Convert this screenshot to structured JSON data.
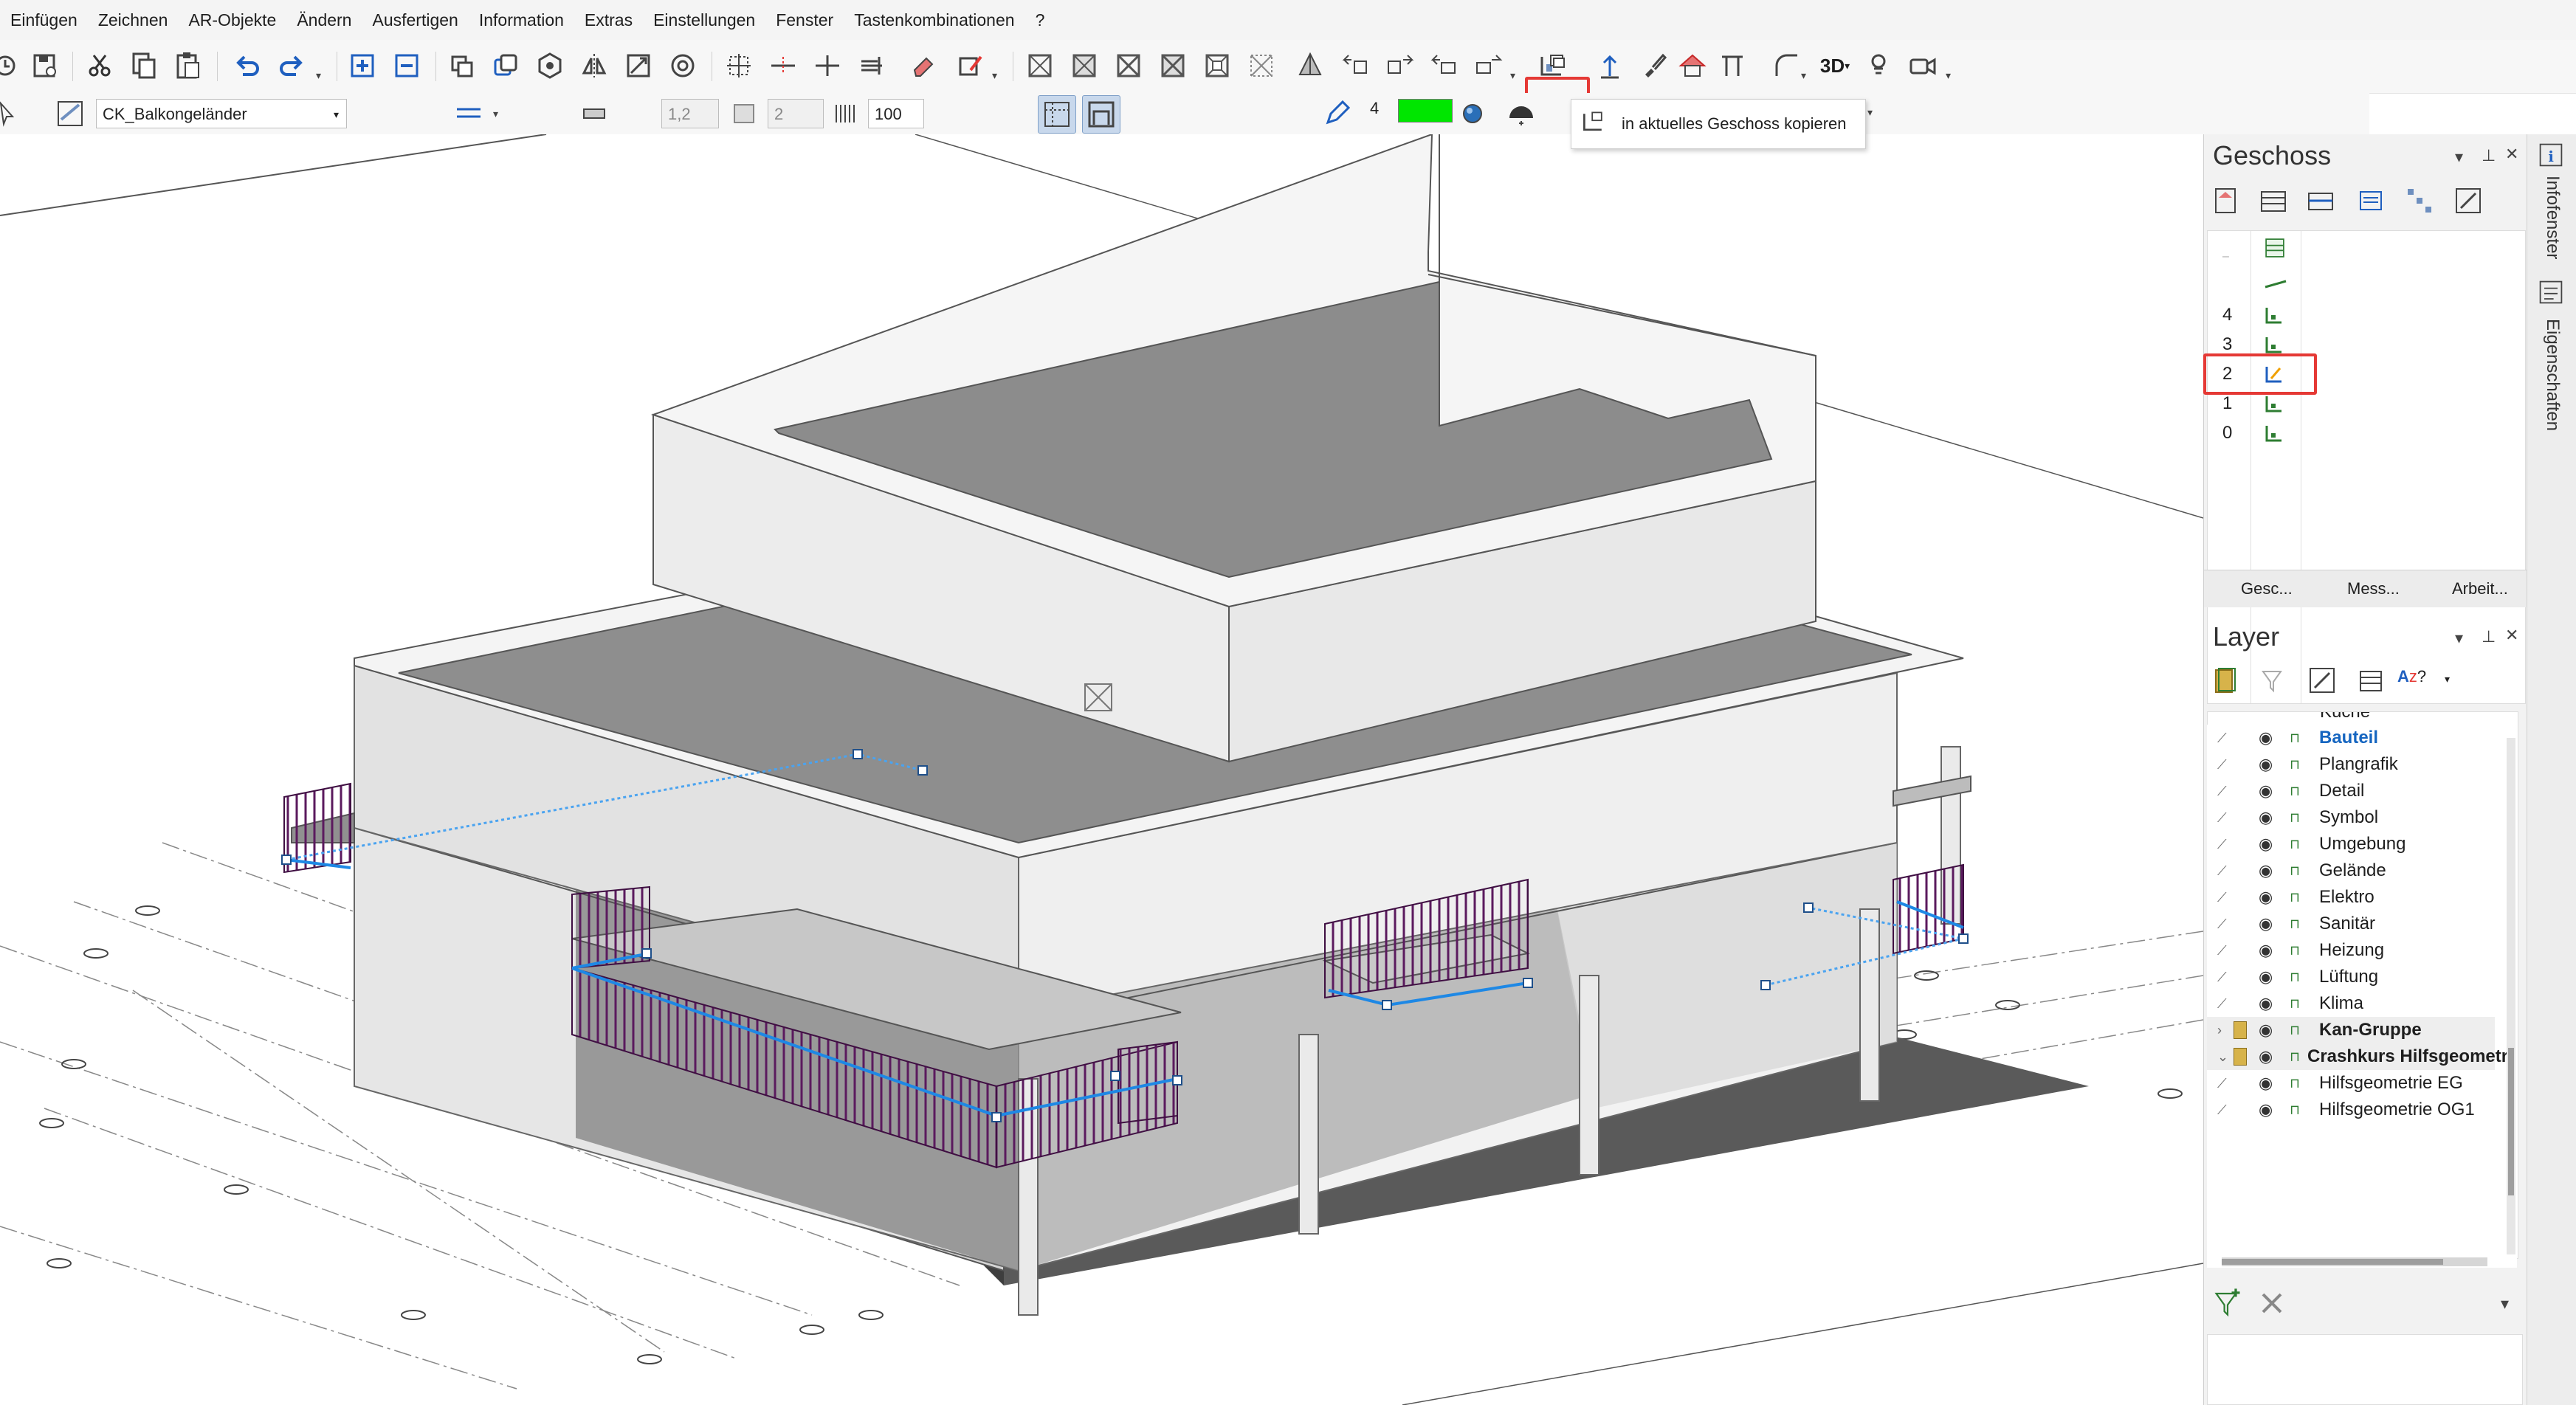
{
  "menu": [
    "Einfügen",
    "Zeichnen",
    "AR-Objekte",
    "Ändern",
    "Ausfertigen",
    "Information",
    "Extras",
    "Einstellungen",
    "Fenster",
    "Tastenkombinationen",
    "?"
  ],
  "toolbar2": {
    "layer_name": "CK_Balkongeländer",
    "value_a": "1,2",
    "value_b": "2",
    "value_c": "100",
    "pen_number": "4",
    "accent_green": "#00e600"
  },
  "tooltip": {
    "text": "in aktuelles Geschoss kopieren"
  },
  "geschoss_panel": {
    "title": "Geschoss",
    "floors": [
      "4",
      "3",
      "2",
      "1",
      "0"
    ],
    "selected_floor": "2",
    "tabs": [
      "Gesc...",
      "Mess...",
      "Arbeit..."
    ]
  },
  "layer_panel": {
    "title": "Layer",
    "top_partial": "Küche",
    "items": [
      {
        "name": "Bauteil",
        "style": "active"
      },
      {
        "name": "Plangrafik",
        "style": "normal"
      },
      {
        "name": "Detail",
        "style": "normal"
      },
      {
        "name": "Symbol",
        "style": "normal"
      },
      {
        "name": "Umgebung",
        "style": "normal"
      },
      {
        "name": "Gelände",
        "style": "normal"
      },
      {
        "name": "Elektro",
        "style": "normal"
      },
      {
        "name": "Sanitär",
        "style": "normal"
      },
      {
        "name": "Heizung",
        "style": "normal"
      },
      {
        "name": "Lüftung",
        "style": "normal"
      },
      {
        "name": "Klima",
        "style": "normal"
      },
      {
        "name": "Kan-Gruppe",
        "style": "group"
      },
      {
        "name": "Crashkurs Hilfsgeometr",
        "style": "group-open"
      },
      {
        "name": "Hilfsgeometrie EG",
        "style": "child"
      },
      {
        "name": "Hilfsgeometrie OG1",
        "style": "child"
      }
    ]
  },
  "side_tabs": [
    "Infofenster",
    "Eigenschaften"
  ],
  "colors": {
    "highlight_red": "#e53935",
    "railing_purple": "#5b1a5e",
    "selection_blue": "#1e88e5",
    "active_layer_blue": "#1565c0"
  }
}
